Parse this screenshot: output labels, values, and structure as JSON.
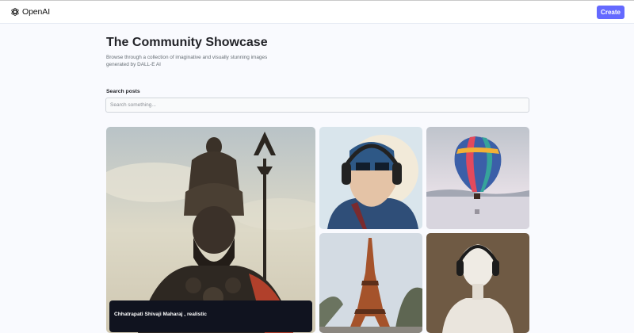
{
  "header": {
    "brand": "OpenAI",
    "brand_icon": "openai-logo-icon",
    "create_label": "Create",
    "accent": "#6469ff"
  },
  "main": {
    "title": "The Community Showcase",
    "subtitle": "Browse through a collection of imaginative and visually stunning images generated by DALL-E AI",
    "search": {
      "label": "Search posts",
      "placeholder": "Search something...",
      "value": ""
    }
  },
  "gallery": {
    "posts": [
      {
        "prompt": "Chhatrapati Shivaji Maharaj , realistic",
        "subject": "warrior-statue"
      },
      {
        "subject": "superhero-with-headphones"
      },
      {
        "subject": "hot-air-balloon"
      },
      {
        "subject": "eiffel-tower"
      },
      {
        "subject": "statue-with-headphones"
      }
    ]
  }
}
